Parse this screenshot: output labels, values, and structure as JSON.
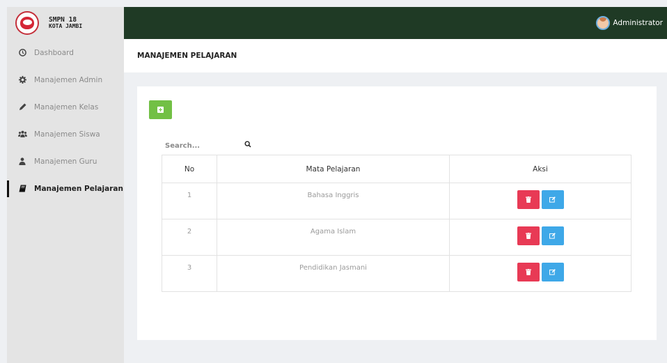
{
  "sidebar": {
    "brand": {
      "line1": "SMPN 18",
      "line2": "KOTA JAMBI"
    },
    "items": [
      {
        "label": "Dashboard",
        "icon": "clock-icon"
      },
      {
        "label": "Manajemen Admin",
        "icon": "gear-icon"
      },
      {
        "label": "Manajemen Kelas",
        "icon": "pencil-icon"
      },
      {
        "label": "Manajemen Siswa",
        "icon": "users-icon"
      },
      {
        "label": "Manajemen Guru",
        "icon": "user-icon"
      },
      {
        "label": "Manajemen Pelajaran",
        "icon": "book-icon",
        "active": true
      }
    ]
  },
  "topbar": {
    "user_name": "Administrator"
  },
  "page": {
    "title": "MANAJEMEN PELAJARAN"
  },
  "search": {
    "placeholder": "Search..."
  },
  "table": {
    "headers": [
      "No",
      "Mata Pelajaran",
      "Aksi"
    ],
    "rows": [
      {
        "no": "1",
        "mapel": "Bahasa Inggris"
      },
      {
        "no": "2",
        "mapel": "Agama Islam"
      },
      {
        "no": "3",
        "mapel": "Pendidikan Jasmani"
      }
    ]
  },
  "colors": {
    "topbar": "#1f3a25",
    "add_button": "#72c045",
    "delete_button": "#e83a55",
    "edit_button": "#3ea8e8",
    "sidebar": "#e4e4e4"
  }
}
